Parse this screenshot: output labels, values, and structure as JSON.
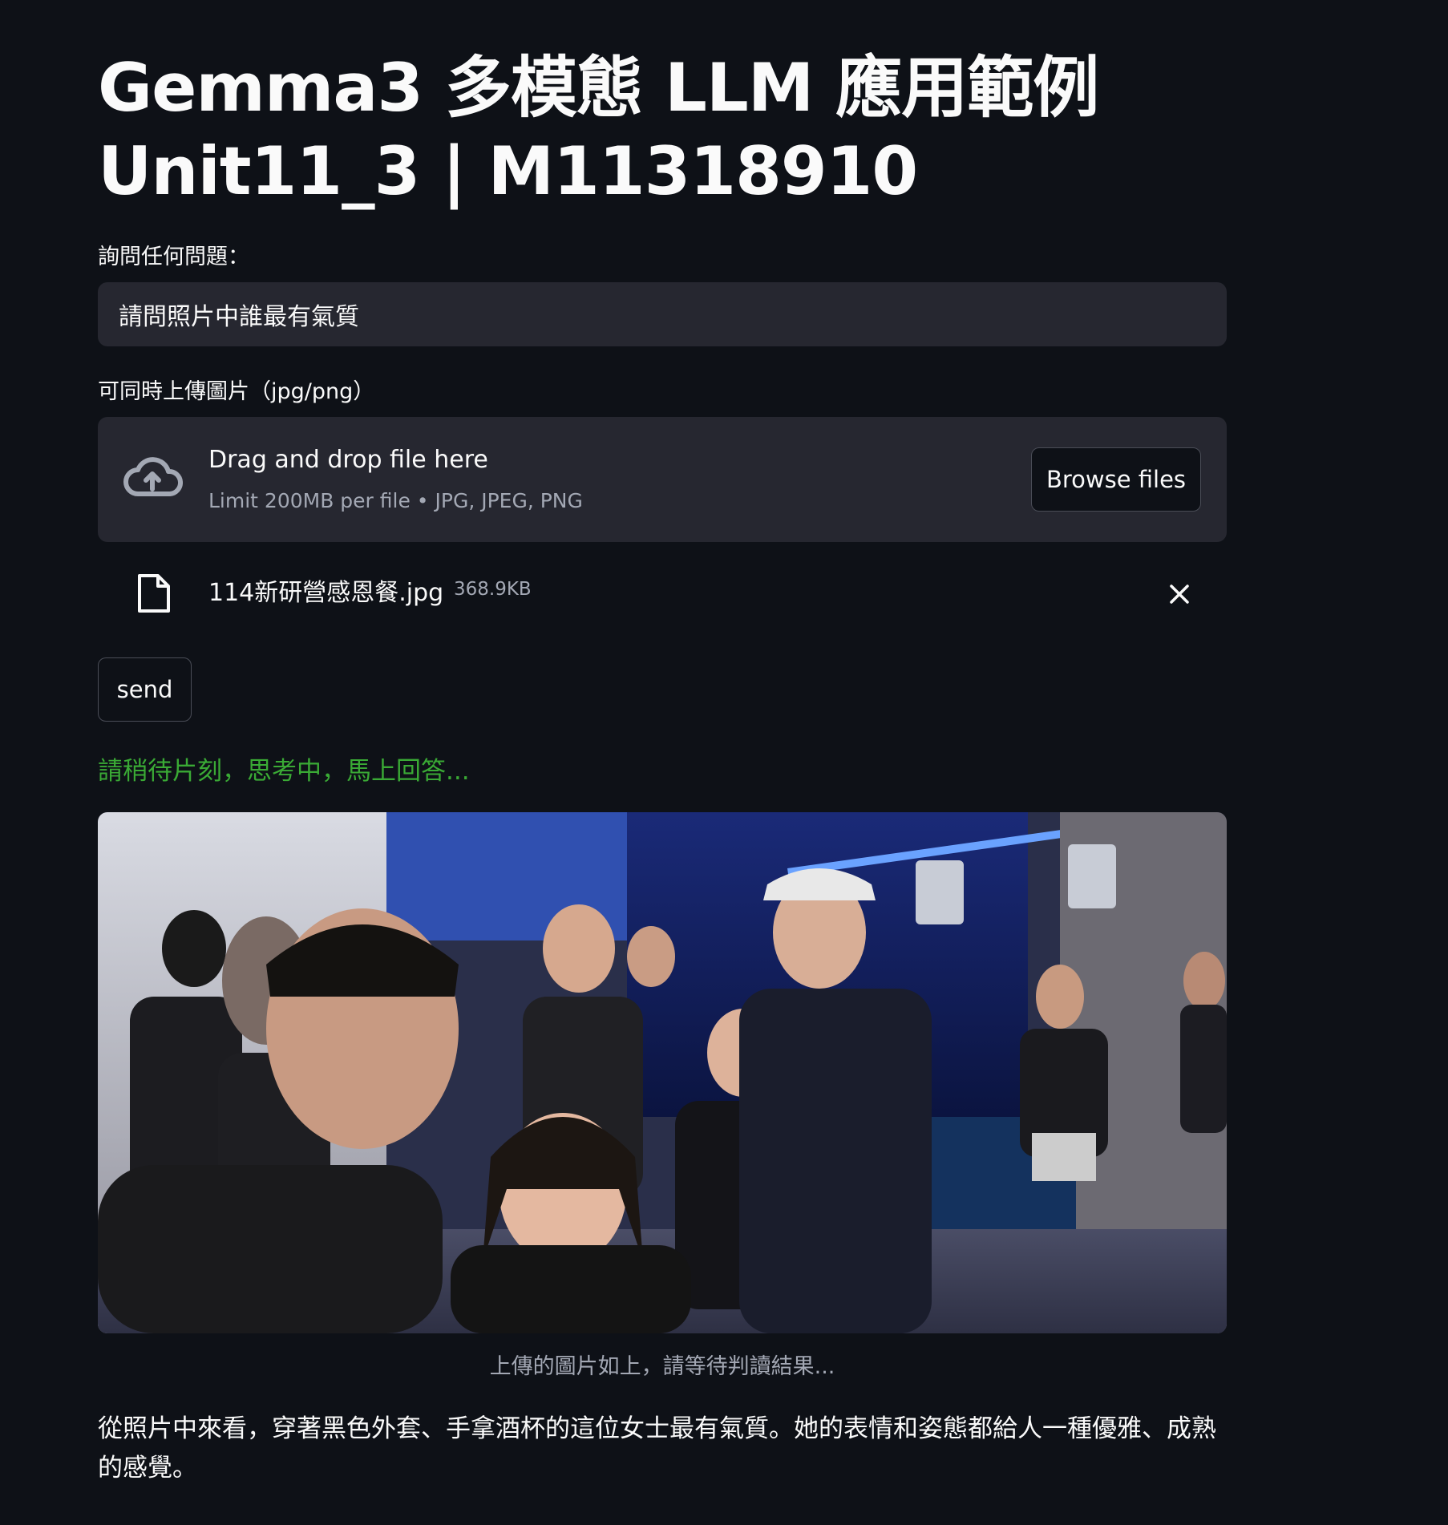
{
  "header": {
    "title_line1": "Gemma3 多模態 LLM 應用範例",
    "title_line2": "Unit11_3 | M11318910"
  },
  "question": {
    "label": "詢問任何問題：",
    "value": "請問照片中誰最有氣質"
  },
  "uploader": {
    "label": "可同時上傳圖片（jpg/png）",
    "dropzone_title": "Drag and drop file here",
    "dropzone_limit": "Limit 200MB per file • JPG, JPEG, PNG",
    "browse_label": "Browse files",
    "icon": "cloud-upload-icon",
    "file": {
      "name": "114新研營感恩餐.jpg",
      "size": "368.9KB",
      "icon": "file-icon"
    }
  },
  "send_label": "send",
  "status_text": "請稍待片刻，思考中，馬上回答...",
  "photo": {
    "caption": "上傳的圖片如上，請等待判讀結果..."
  },
  "answer": "從照片中來看，穿著黑色外套、手拿酒杯的這位女士最有氣質。她的表情和姿態都給人一種優雅、成熟的感覺。",
  "colors": {
    "background": "#0e1117",
    "surface": "#262730",
    "status_green": "#3aaa35",
    "muted_text": "#a3a8b4"
  }
}
